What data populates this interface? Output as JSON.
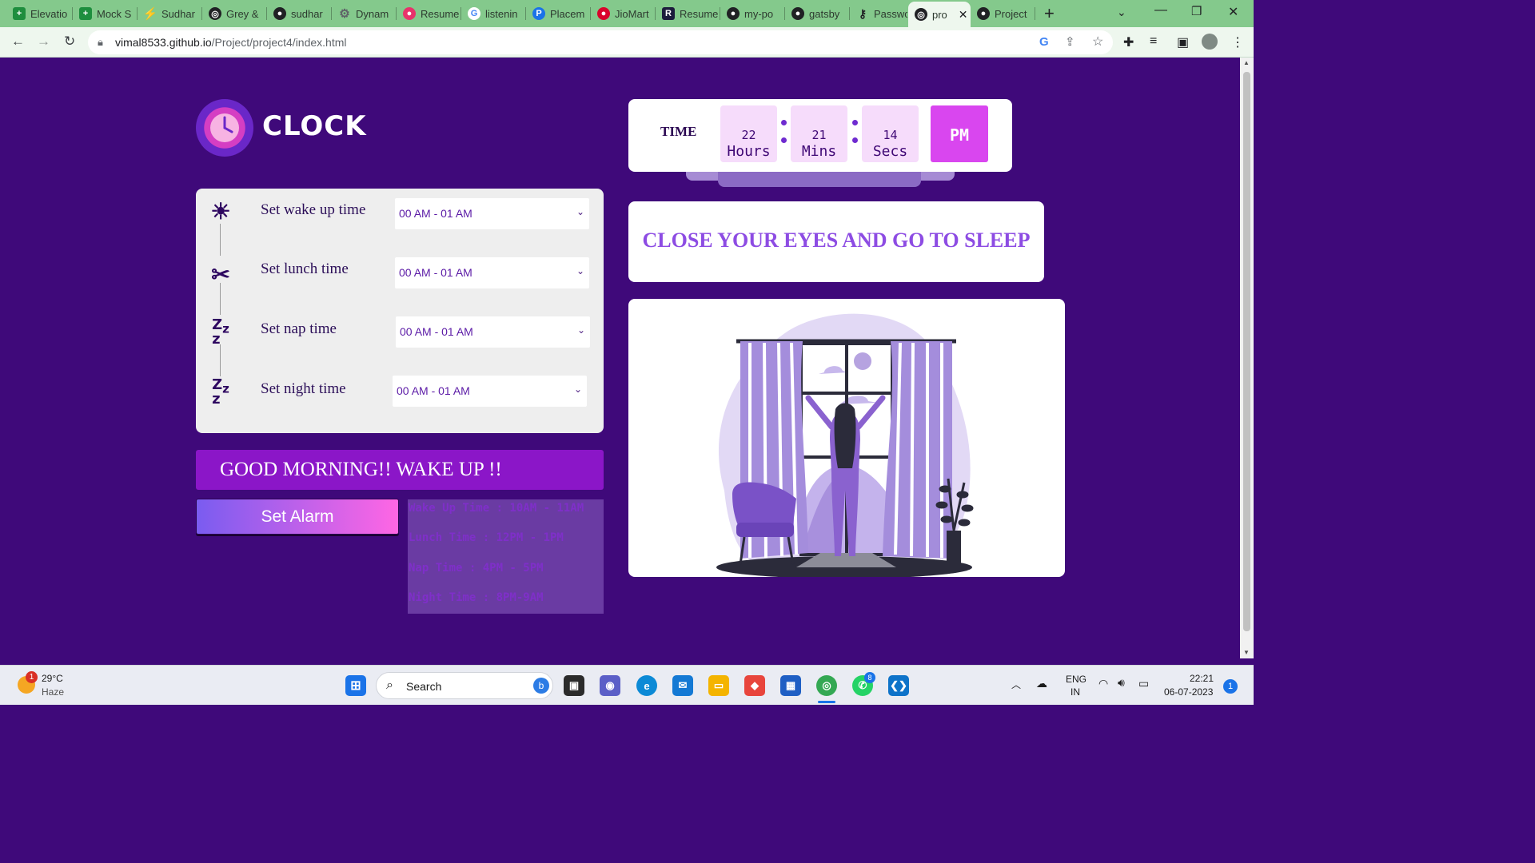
{
  "browser": {
    "tabs": [
      {
        "label": "Elevatio",
        "icon": "sheets-icon"
      },
      {
        "label": "Mock S",
        "icon": "sheets-icon"
      },
      {
        "label": "Sudhar",
        "icon": "bolt-icon"
      },
      {
        "label": "Grey &",
        "icon": "globe-icon"
      },
      {
        "label": "sudhar",
        "icon": "github-icon"
      },
      {
        "label": "Dynam",
        "icon": "gear-icon"
      },
      {
        "label": "Resume",
        "icon": "resume-icon"
      },
      {
        "label": "listenin",
        "icon": "google-icon"
      },
      {
        "label": "Placem",
        "icon": "placement-icon"
      },
      {
        "label": "JioMart",
        "icon": "jiomart-icon"
      },
      {
        "label": "Resume",
        "icon": "r-icon"
      },
      {
        "label": "my-po",
        "icon": "github-icon"
      },
      {
        "label": "gatsby",
        "icon": "github-icon"
      },
      {
        "label": "Passwo",
        "icon": "key-icon"
      },
      {
        "label": "pro",
        "icon": "globe-icon"
      },
      {
        "label": "Project",
        "icon": "github-icon"
      }
    ],
    "url_host": "vimal8533.github.io",
    "url_path": "/Project/project4/index.html"
  },
  "page": {
    "logo_text": "CLOCK",
    "time_label": "TIME",
    "hours": "22",
    "hours_unit": "Hours",
    "mins": "21",
    "mins_unit": "Mins",
    "secs": "14",
    "secs_unit": "Secs",
    "ampm": "PM",
    "message": "CLOSE YOUR EYES AND GO TO SLEEP",
    "alarms": [
      {
        "label": "Set wake up time",
        "value": "00 AM - 01 AM",
        "icon": "sun-icon"
      },
      {
        "label": "Set lunch time",
        "value": "00 AM - 01 AM",
        "icon": "utensils-icon"
      },
      {
        "label": "Set nap time",
        "value": "00 AM - 01 AM",
        "icon": "zzz-icon"
      },
      {
        "label": "Set night time",
        "value": "00 AM - 01 AM",
        "icon": "zzz-icon"
      }
    ],
    "greeting": "GOOD MORNING!! WAKE UP !!",
    "set_alarm": "Set Alarm",
    "schedule": [
      "Wake Up Time : 10AM - 11AM",
      "Lunch Time : 12PM - 1PM",
      "Nap Time : 4PM - 5PM",
      "Night Time : 8PM-9AM"
    ]
  },
  "taskbar": {
    "weather_temp": "29°C",
    "weather_desc": "Haze",
    "weather_badge": "1",
    "search_placeholder": "Search",
    "lang_1": "ENG",
    "lang_2": "IN",
    "time": "22:21",
    "date": "06-07-2023",
    "notification_count": "1",
    "whatsapp_badge": "8"
  }
}
